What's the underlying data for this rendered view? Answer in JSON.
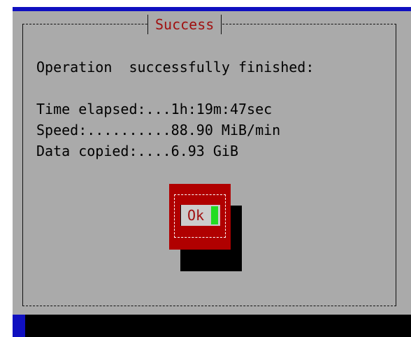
{
  "dialog": {
    "title": "Success",
    "message": "Operation  successfully finished:",
    "details": {
      "time_elapsed": "Time elapsed:...1h:19m:47sec",
      "speed": "Speed:..........88.90 MiB/min",
      "data_copied": "Data copied:....6.93 GiB"
    },
    "ok_label": "Ok"
  },
  "colors": {
    "background": "#1010c0",
    "dialog": "#aaaaaa",
    "title_text": "#a01010",
    "button": "#b00000",
    "cursor": "#22dd22"
  }
}
